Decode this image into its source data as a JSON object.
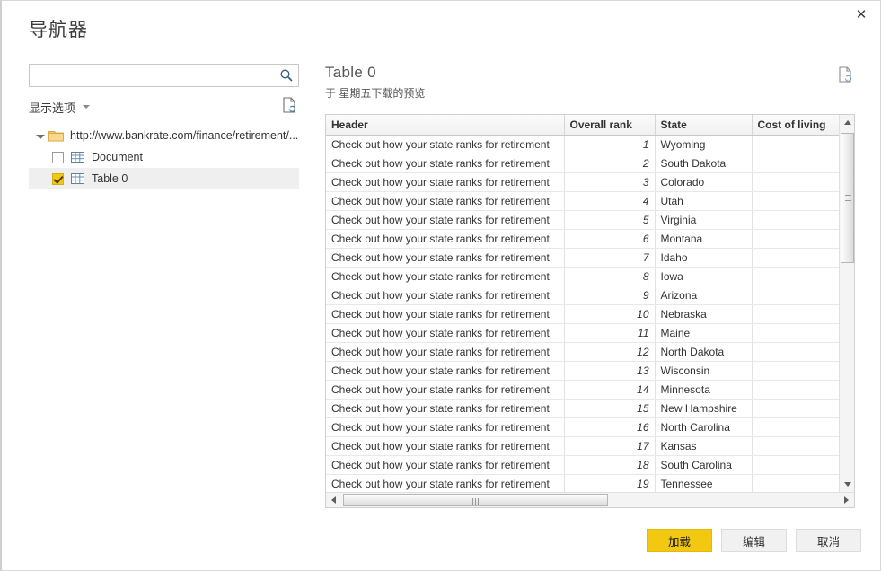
{
  "dialog": {
    "title": "导航器",
    "close_label": "✕"
  },
  "left": {
    "search": {
      "value": "",
      "placeholder": "",
      "icon": "search-icon"
    },
    "display_options_label": "显示选项",
    "refresh_icon": "document-refresh-icon",
    "tree": {
      "root": {
        "label": "http://www.bankrate.com/finance/retirement/...",
        "icon": "folder-icon",
        "expanded": true
      },
      "children": [
        {
          "label": "Document",
          "icon": "table-icon",
          "checked": false,
          "selected": false
        },
        {
          "label": "Table 0",
          "icon": "table-icon",
          "checked": true,
          "selected": true
        }
      ]
    }
  },
  "preview": {
    "title": "Table 0",
    "subtitle": "于 星期五下载的预览",
    "refresh_icon": "document-refresh-icon",
    "columns": [
      "Header",
      "Overall rank",
      "State",
      "Cost of living",
      ""
    ],
    "rows": [
      [
        "Check out how your state ranks for retirement",
        "1",
        "Wyoming",
        "",
        ""
      ],
      [
        "Check out how your state ranks for retirement",
        "2",
        "South Dakota",
        "",
        ""
      ],
      [
        "Check out how your state ranks for retirement",
        "3",
        "Colorado",
        "",
        ""
      ],
      [
        "Check out how your state ranks for retirement",
        "4",
        "Utah",
        "",
        ""
      ],
      [
        "Check out how your state ranks for retirement",
        "5",
        "Virginia",
        "",
        ""
      ],
      [
        "Check out how your state ranks for retirement",
        "6",
        "Montana",
        "",
        ""
      ],
      [
        "Check out how your state ranks for retirement",
        "7",
        "Idaho",
        "",
        ""
      ],
      [
        "Check out how your state ranks for retirement",
        "8",
        "Iowa",
        "",
        ""
      ],
      [
        "Check out how your state ranks for retirement",
        "9",
        "Arizona",
        "",
        ""
      ],
      [
        "Check out how your state ranks for retirement",
        "10",
        "Nebraska",
        "",
        ""
      ],
      [
        "Check out how your state ranks for retirement",
        "11",
        "Maine",
        "",
        ""
      ],
      [
        "Check out how your state ranks for retirement",
        "12",
        "North Dakota",
        "",
        ""
      ],
      [
        "Check out how your state ranks for retirement",
        "13",
        "Wisconsin",
        "",
        ""
      ],
      [
        "Check out how your state ranks for retirement",
        "14",
        "Minnesota",
        "",
        ""
      ],
      [
        "Check out how your state ranks for retirement",
        "15",
        "New Hampshire",
        "",
        ""
      ],
      [
        "Check out how your state ranks for retirement",
        "16",
        "North Carolina",
        "",
        ""
      ],
      [
        "Check out how your state ranks for retirement",
        "17",
        "Kansas",
        "",
        ""
      ],
      [
        "Check out how your state ranks for retirement",
        "18",
        "South Carolina",
        "",
        ""
      ],
      [
        "Check out how your state ranks for retirement",
        "19",
        "Tennessee",
        "",
        ""
      ]
    ]
  },
  "footer": {
    "load_label": "加载",
    "edit_label": "编辑",
    "cancel_label": "取消"
  },
  "colors": {
    "accent_yellow": "#f2c811",
    "dialog_bg": "#ffffff",
    "selected_row": "#efefef",
    "grid_border": "#d0d0d0"
  }
}
